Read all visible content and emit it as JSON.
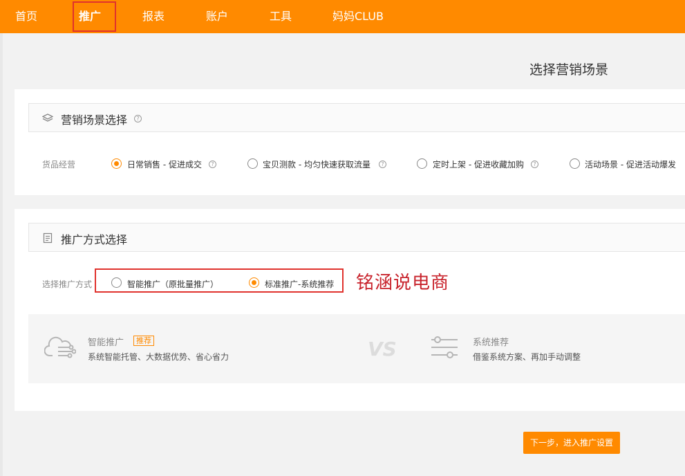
{
  "nav": {
    "items": [
      {
        "label": "首页"
      },
      {
        "label": "推广"
      },
      {
        "label": "报表"
      },
      {
        "label": "账户"
      },
      {
        "label": "工具"
      },
      {
        "label": "妈妈CLUB"
      }
    ],
    "active": "推广"
  },
  "page_title": "选择营销场景",
  "scene_section": {
    "title": "营销场景选择",
    "row_label": "货品经营",
    "options": [
      {
        "label": "日常销售 - 促进成交",
        "checked": true
      },
      {
        "label": "宝贝测款 - 均匀快速获取流量",
        "checked": false
      },
      {
        "label": "定时上架 - 促进收藏加购",
        "checked": false
      },
      {
        "label": "活动场景 - 促进活动爆发",
        "checked": false
      }
    ]
  },
  "method_section": {
    "title": "推广方式选择",
    "row_label": "选择推广方式",
    "options": [
      {
        "label": "智能推广（原批量推广）",
        "checked": false
      },
      {
        "label": "标准推广-系统推荐",
        "checked": true
      }
    ]
  },
  "watermark": "铭涵说电商",
  "compare": {
    "left": {
      "title": "智能推广",
      "badge": "推荐",
      "desc": "系统智能托管、大数据优势、省心省力"
    },
    "vs": "VS",
    "right": {
      "title": "系统推荐",
      "desc": "借鉴系统方案、再加手动调整"
    }
  },
  "next_button": "下一步，进入推广设置",
  "colors": {
    "brand": "#ff8a00",
    "highlight_box": "#e0322d",
    "watermark": "#c8232c"
  }
}
